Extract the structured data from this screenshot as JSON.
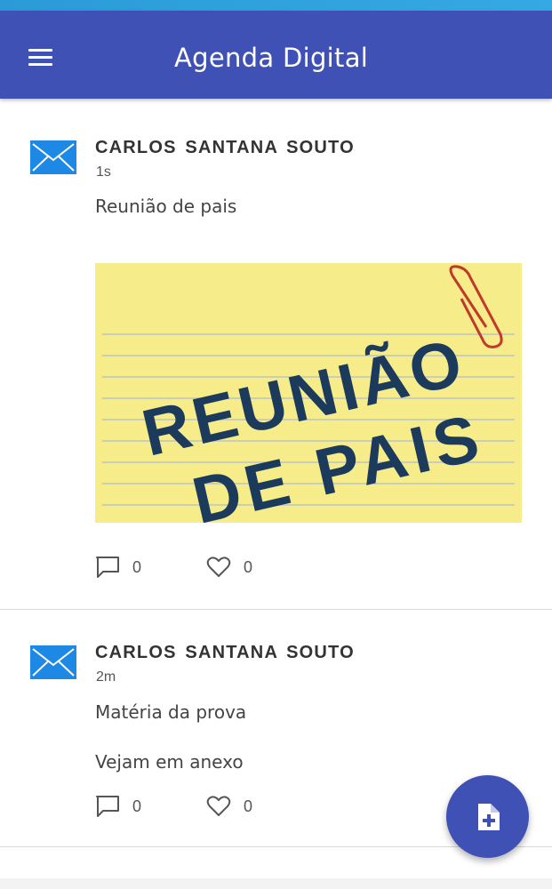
{
  "status_bar": {
    "color": "#2a9bd8"
  },
  "app_bar": {
    "title": "Agenda Digital",
    "menu_icon": "hamburger-menu-icon",
    "color": "#3f51b5"
  },
  "posts": [
    {
      "icon": "envelope-icon",
      "author": "CARLOS SANTANA SOUTO",
      "time": "1s",
      "text": "Reunião de pais",
      "image": {
        "line1": "REUNIÃO",
        "line2": "DE PAIS"
      },
      "comments": "0",
      "likes": "0"
    },
    {
      "icon": "envelope-icon",
      "author": "CARLOS SANTANA SOUTO",
      "time": "2m",
      "text": "Matéria da prova",
      "text2": "Vejam em anexo",
      "comments": "0",
      "likes": "0"
    }
  ],
  "fab": {
    "icon": "add-document-icon"
  },
  "colors": {
    "primary": "#3f51b5",
    "envelope": "#1e88e5",
    "note_yellow": "#f7ec8a",
    "note_ink": "#1b3a5c",
    "paperclip": "#c0392b"
  }
}
